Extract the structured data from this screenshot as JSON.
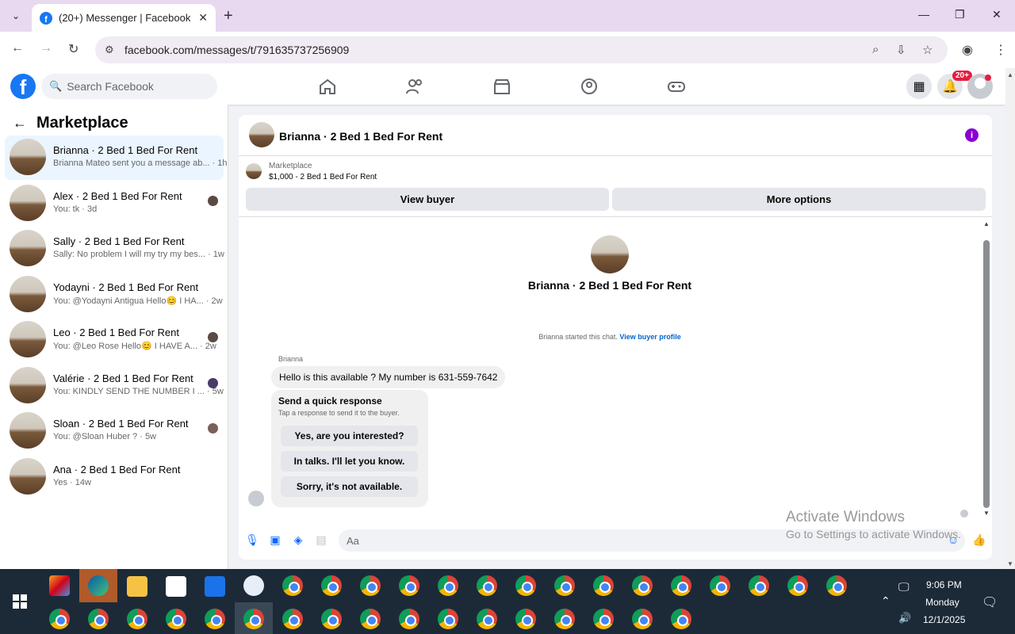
{
  "browser": {
    "tab_title": "(20+) Messenger | Facebook",
    "url": "facebook.com/messages/t/791635737256909"
  },
  "fb": {
    "search_placeholder": "Search Facebook",
    "notif_badge": "20+"
  },
  "sidebar": {
    "title": "Marketplace",
    "conversations": [
      {
        "name": "Brianna · 2 Bed 1 Bed For Rent",
        "snippet": "Brianna Mateo sent you a message ab... · 1h",
        "active": true
      },
      {
        "name": "Alex · 2 Bed 1 Bed For Rent",
        "snippet": "You: tk · 3d"
      },
      {
        "name": "Sally · 2 Bed 1 Bed For Rent",
        "snippet": "Sally: No problem I will my try my bes... · 1w"
      },
      {
        "name": "Yodayni · 2 Bed 1 Bed For Rent",
        "snippet": "You: @Yodayni Antigua Hello😊 I HA... · 2w"
      },
      {
        "name": "Leo · 2 Bed 1 Bed For Rent",
        "snippet": "You: @Leo Rose Hello😊 I HAVE A... · 2w"
      },
      {
        "name": "Valérie · 2 Bed 1 Bed For Rent",
        "snippet": "You: KINDLY SEND THE NUMBER I ... · 5w"
      },
      {
        "name": "Sloan · 2 Bed 1 Bed For Rent",
        "snippet": "You: @Sloan Huber ? · 5w"
      },
      {
        "name": "Ana · 2 Bed 1 Bed For Rent",
        "snippet": "Yes · 14w"
      }
    ]
  },
  "chat": {
    "header_name": "Brianna · 2 Bed 1 Bed For Rent",
    "marketplace_label": "Marketplace",
    "listing": "$1,000 - 2 Bed 1 Bed For Rent",
    "view_buyer": "View buyer",
    "more_options": "More options",
    "center_name": "Brianna · 2 Bed 1 Bed For Rent",
    "started_text": "Brianna started this chat.",
    "view_profile": "View buyer profile",
    "sender": "Brianna",
    "message": "Hello is this available ? My number is 631-559-7642",
    "quick_title": "Send a quick response",
    "quick_sub": "Tap a response to send it to the buyer.",
    "quick_options": [
      "Yes, are you interested?",
      "In talks. I'll let you know.",
      "Sorry, it's not available."
    ],
    "composer_placeholder": "Aa"
  },
  "watermark": {
    "line1": "Activate Windows",
    "line2": "Go to Settings to activate Windows."
  },
  "tray": {
    "time": "9:06 PM",
    "day": "Monday",
    "date": "12/1/2025"
  }
}
